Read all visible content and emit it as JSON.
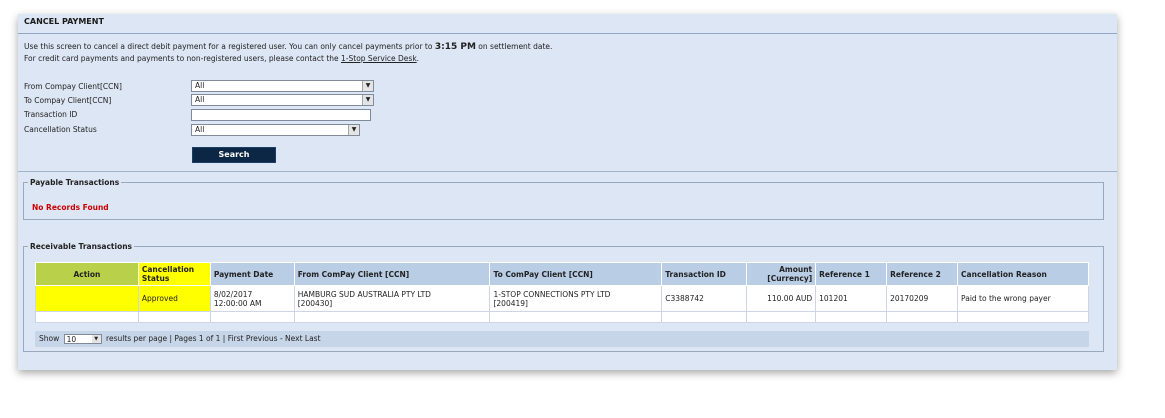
{
  "page": {
    "title": "CANCEL PAYMENT",
    "intro_line1_a": "Use this screen to cancel a direct debit payment for a registered user. You can only cancel payments prior to ",
    "intro_time": "3:15 PM",
    "intro_line1_b": " on settlement date.",
    "intro_line2_a": "For credit card payments and payments to non-registered users, please contact the ",
    "intro_link": "1-Stop Service Desk",
    "intro_line2_b": "."
  },
  "filters": {
    "from_label": "From Compay Client[CCN]",
    "from_value": "All",
    "to_label": "To Compay Client[CCN]",
    "to_value": "All",
    "txn_label": "Transaction ID",
    "txn_value": "",
    "status_label": "Cancellation Status",
    "status_value": "All",
    "search_label": "Search"
  },
  "payable": {
    "legend": "Payable Transactions",
    "empty_text": "No Records Found"
  },
  "receivable": {
    "legend": "Receivable Transactions",
    "headers": [
      "Action",
      "Cancellation Status",
      "Payment Date",
      "From ComPay Client [CCN]",
      "To ComPay Client [CCN]",
      "Transaction ID",
      "Amount [Currency]",
      "Reference 1",
      "Reference 2",
      "Cancellation Reason"
    ],
    "rows": [
      {
        "action": "",
        "status": "Approved",
        "date": "8/02/2017\n12:00:00 AM",
        "from": "HAMBURG SUD AUSTRALIA PTY LTD\n[200430]",
        "to": "1-STOP CONNECTIONS PTY LTD\n[200419]",
        "txn_id": "C3388742",
        "amount": "110.00 AUD",
        "ref1": "101201",
        "ref2": "20170209",
        "reason": "Paid to the wrong payer"
      }
    ]
  },
  "pager": {
    "show": "Show",
    "per_page": "10",
    "text": "results per page | Pages 1 of 1 | First Previous - Next Last"
  },
  "colors": {
    "panel_bg": "#dce6f4",
    "header_bg": "#b9cde5",
    "highlight": "#ffff00",
    "button_bg": "#0c2645",
    "error_text": "#cc0000"
  }
}
